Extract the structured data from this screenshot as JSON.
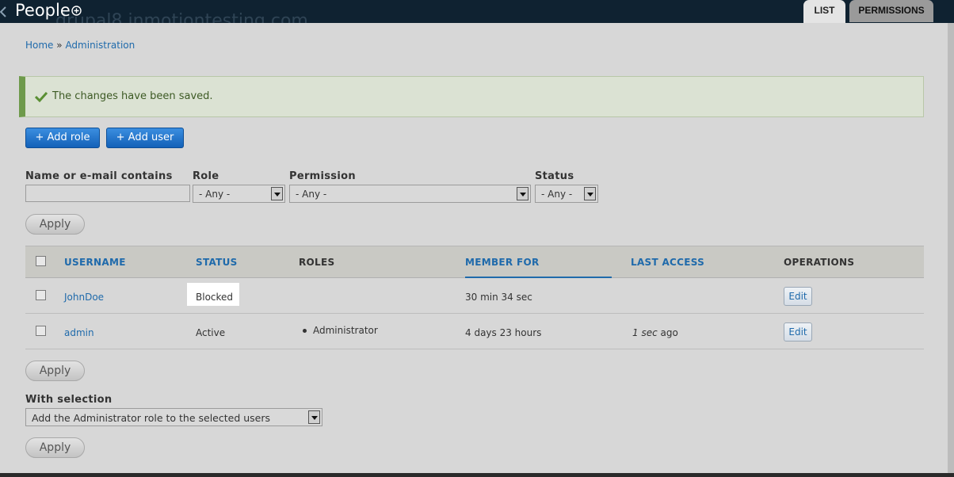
{
  "header": {
    "title": "People",
    "background_site": "drupal8.inmotiontesting.com",
    "tabs": [
      {
        "label": "LIST",
        "active": true
      },
      {
        "label": "PERMISSIONS",
        "active": false
      }
    ]
  },
  "breadcrumb": {
    "items": [
      "Home",
      "Administration"
    ],
    "separator": "»"
  },
  "status_message": {
    "text": "The changes have been saved.",
    "type": "status"
  },
  "actions": {
    "add_role": "+ Add role",
    "add_user": "+ Add user"
  },
  "filters": {
    "name_label": "Name or e-mail contains",
    "name_value": "",
    "role_label": "Role",
    "role_value": "- Any -",
    "permission_label": "Permission",
    "permission_value": "- Any -",
    "status_label": "Status",
    "status_value": "- Any -",
    "apply": "Apply"
  },
  "table": {
    "columns": [
      "USERNAME",
      "STATUS",
      "ROLES",
      "MEMBER FOR",
      "LAST ACCESS",
      "OPERATIONS"
    ],
    "active_sort": "MEMBER FOR",
    "rows": [
      {
        "username": "JohnDoe",
        "status": "Blocked",
        "roles": "",
        "member_for": "30 min 34 sec",
        "last_access_value": "",
        "last_access_suffix": "",
        "operation": "Edit"
      },
      {
        "username": "admin",
        "status": "Active",
        "roles": "Administrator",
        "member_for": "4 days 23 hours",
        "last_access_value": "1 sec",
        "last_access_suffix": "ago",
        "operation": "Edit"
      }
    ]
  },
  "bulk": {
    "apply_top": "Apply",
    "label": "With selection",
    "action_value": "Add the Administrator role to the selected users",
    "apply_bottom": "Apply"
  },
  "colors": {
    "header_bg": "#0f2231",
    "overlay_bg": "#d7d7d7",
    "link": "#1f6aab",
    "primary_button": "#1361b8",
    "status_border": "#6e9a4b"
  }
}
